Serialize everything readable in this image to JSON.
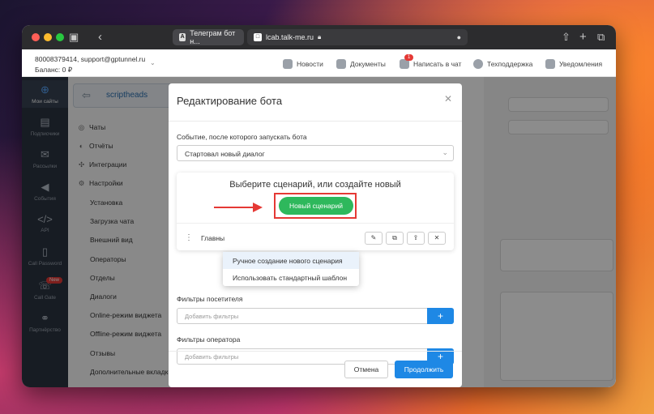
{
  "browser": {
    "tabs": [
      {
        "label": "Телеграм бот н..."
      },
      {
        "label": "lcab.talk-me.ru"
      }
    ]
  },
  "account": {
    "line1": "80008379414, support@gptunnel.ru",
    "line2": "Баланс: 0 ₽"
  },
  "toplinks": [
    {
      "label": "Новости"
    },
    {
      "label": "Документы"
    },
    {
      "label": "Написать в чат",
      "badge": "1"
    },
    {
      "label": "Техподдержка"
    },
    {
      "label": "Уведомления"
    }
  ],
  "sidebar": [
    {
      "label": "Мои сайты",
      "icon": "globe-icon",
      "glyph": "⊕"
    },
    {
      "label": "Подписчики",
      "icon": "id-card-icon",
      "glyph": "▤"
    },
    {
      "label": "Рассылки",
      "icon": "mail-icon",
      "glyph": "✉"
    },
    {
      "label": "События",
      "icon": "megaphone-icon",
      "glyph": "◀"
    },
    {
      "label": "API",
      "icon": "code-icon",
      "glyph": "</>"
    },
    {
      "label": "Call Password",
      "icon": "phone-icon",
      "glyph": "▯"
    },
    {
      "label": "Call Gate",
      "icon": "gate-icon",
      "glyph": "☏",
      "badge": "New"
    },
    {
      "label": "Партнёрство",
      "icon": "handshake-icon",
      "glyph": "⚭"
    }
  ],
  "bot": {
    "name": "scriptheads"
  },
  "menu": [
    {
      "label": "Чаты",
      "icon": "chat-icon",
      "glyph": "◎"
    },
    {
      "label": "Отчёты",
      "icon": "report-icon",
      "glyph": "◐"
    },
    {
      "label": "Интеграции",
      "icon": "integration-icon",
      "glyph": "✣"
    },
    {
      "label": "Настройки",
      "icon": "gear-icon",
      "glyph": "⚙"
    },
    {
      "label": "Установка"
    },
    {
      "label": "Загрузка чата"
    },
    {
      "label": "Внешний вид"
    },
    {
      "label": "Операторы"
    },
    {
      "label": "Отделы"
    },
    {
      "label": "Диалоги"
    },
    {
      "label": "Online-режим виджета"
    },
    {
      "label": "Offline-режим виджета"
    },
    {
      "label": "Отзывы"
    },
    {
      "label": "Дополнительные вкладки"
    }
  ],
  "modal": {
    "title": "Редактирование бота",
    "event_label": "Событие, после которого запускать бота",
    "event_value": "Стартовал новый диалог",
    "scenario_title": "Выберите сценарий, или создайте новый",
    "new_scenario_btn": "Новый сценарий",
    "scenario_row_name": "Главны",
    "dropdown": [
      {
        "label": "Ручное создание нового сценария"
      },
      {
        "label": "Использовать стандартный шаблон"
      }
    ],
    "visitor_filters_label": "Фильтры посетителя",
    "visitor_filters_placeholder": "Добавить фильтры",
    "operator_filters_label": "Фильтры оператора",
    "operator_filters_placeholder": "Добавить фильтры",
    "cancel": "Отмена",
    "continue": "Продолжить"
  },
  "colors": {
    "primary": "#1e88e5",
    "success": "#2eb85c",
    "highlight": "#e53935",
    "sidebar": "#2b3440"
  }
}
